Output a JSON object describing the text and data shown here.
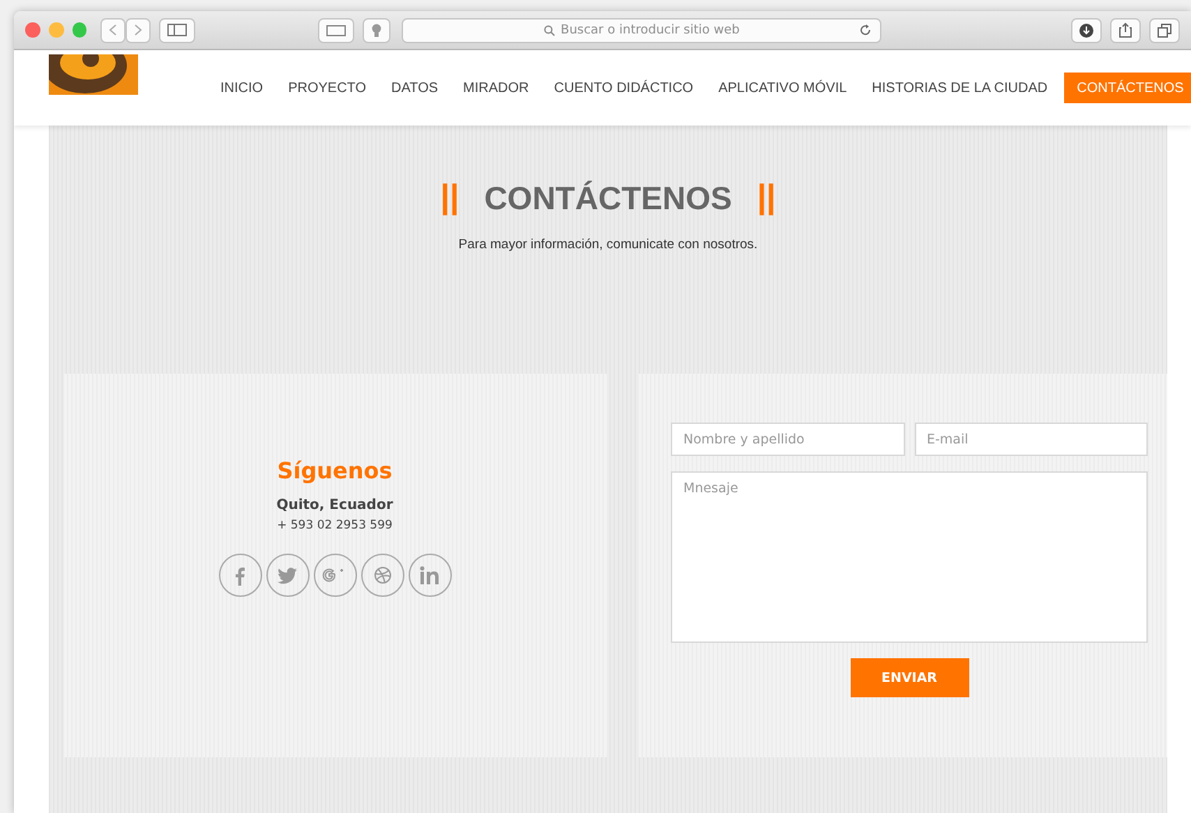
{
  "browser": {
    "address_placeholder": "Buscar o introducir sitio web"
  },
  "nav": [
    {
      "label": "INICIO",
      "selected": false
    },
    {
      "label": "PROYECTO",
      "selected": false
    },
    {
      "label": "DATOS",
      "selected": false
    },
    {
      "label": "MIRADOR",
      "selected": false
    },
    {
      "label": "CUENTO DIDÁCTICO",
      "selected": false
    },
    {
      "label": "APLICATIVO MÓVIL",
      "selected": false
    },
    {
      "label": "HISTORIAS DE LA CIUDAD",
      "selected": false
    },
    {
      "label": "CONTÁCTENOS",
      "selected": true
    }
  ],
  "heading": {
    "marker": "||",
    "title": "CONTÁCTENOS",
    "subtitle": "Para mayor información, comunicate con nosotros."
  },
  "social": {
    "title": "Síguenos",
    "city": "Quito, Ecuador",
    "phone": "+ 593 02 2953 599",
    "links": [
      {
        "kind": "facebook"
      },
      {
        "kind": "twitter"
      },
      {
        "kind": "googleplus"
      },
      {
        "kind": "dribbble"
      },
      {
        "kind": "linkedin"
      }
    ]
  },
  "form": {
    "name_placeholder": "Nombre y apellido",
    "email_placeholder": "E-mail",
    "message_placeholder": "Mnesaje",
    "submit": "ENVIAR"
  }
}
